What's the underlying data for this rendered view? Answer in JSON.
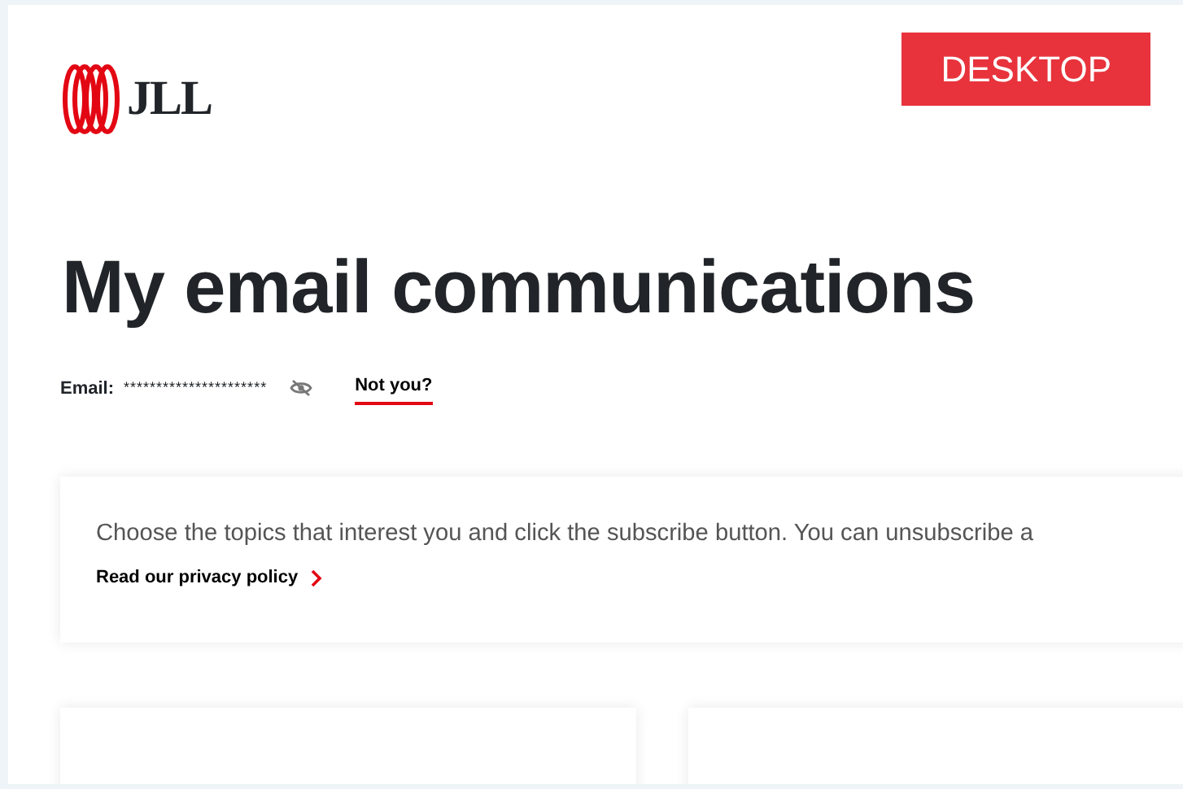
{
  "badge": "DESKTOP",
  "logo": {
    "text": "JLL"
  },
  "title": "My email communications",
  "email": {
    "label": "Email:",
    "value": "**********************",
    "masked": true,
    "link": "Not you?"
  },
  "intro": {
    "text": "Choose the topics that interest you and click the subscribe button. You can unsubscribe a",
    "link": "Read our privacy policy"
  },
  "cards": [
    {
      "kind": "topic"
    },
    {
      "kind": "topic"
    }
  ]
}
